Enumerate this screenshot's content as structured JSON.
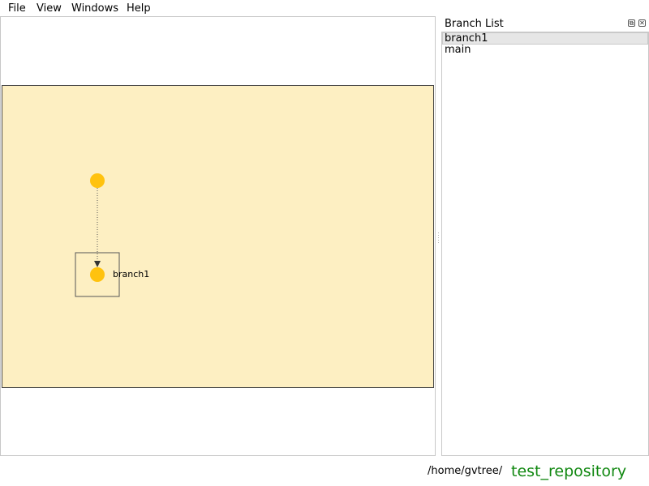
{
  "menu": {
    "file": "File",
    "view": "View",
    "windows": "Windows",
    "help": "Help"
  },
  "graph": {
    "node_color": "#ffc20e",
    "scene_color": "#fdefc2",
    "selected_label": "branch1"
  },
  "branch_list": {
    "title": "Branch List",
    "float_icon": "float-icon",
    "close_icon": "close-icon",
    "items": [
      {
        "label": "branch1",
        "selected": true
      },
      {
        "label": "main",
        "selected": false
      }
    ]
  },
  "status": {
    "path": "/home/gvtree/",
    "repo": "test_repository",
    "repo_color": "#118811"
  }
}
